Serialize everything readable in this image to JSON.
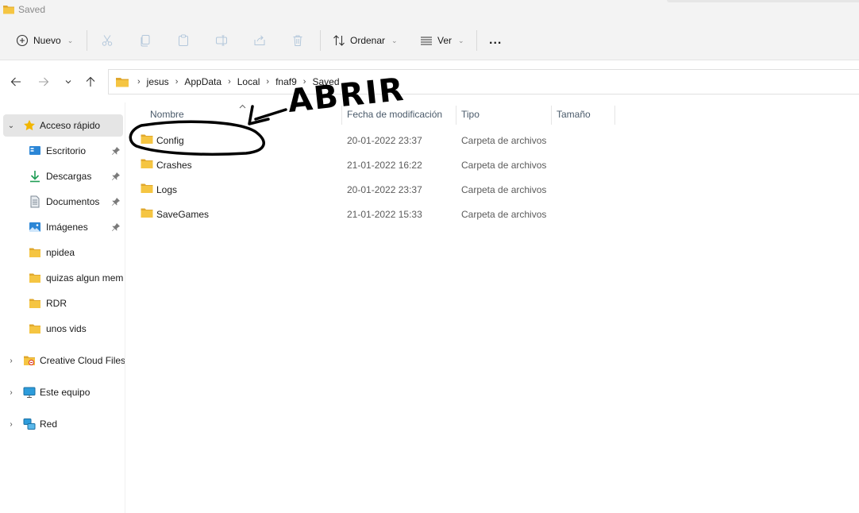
{
  "window": {
    "title": "Saved"
  },
  "toolbar": {
    "new_label": "Nuevo",
    "sort_label": "Ordenar",
    "view_label": "Ver",
    "more_label": "..."
  },
  "breadcrumb": [
    "jesus",
    "AppData",
    "Local",
    "fnaf9",
    "Saved"
  ],
  "sidebar": {
    "quick_access_label": "Acceso rápido",
    "items": [
      {
        "label": "Escritorio",
        "icon": "desktop-icon",
        "pinned": true
      },
      {
        "label": "Descargas",
        "icon": "download-icon",
        "pinned": true
      },
      {
        "label": "Documentos",
        "icon": "document-icon",
        "pinned": true
      },
      {
        "label": "Imágenes",
        "icon": "pictures-icon",
        "pinned": true
      },
      {
        "label": "npidea",
        "icon": "folder-icon",
        "pinned": false
      },
      {
        "label": "quizas algun mem",
        "icon": "folder-icon",
        "pinned": false
      },
      {
        "label": "RDR",
        "icon": "folder-icon",
        "pinned": false
      },
      {
        "label": "unos vids",
        "icon": "folder-icon",
        "pinned": false
      }
    ],
    "creative_cloud_label": "Creative Cloud Files",
    "this_pc_label": "Este equipo",
    "network_label": "Red"
  },
  "columns": {
    "name": "Nombre",
    "date": "Fecha de modificación",
    "type": "Tipo",
    "size": "Tamaño"
  },
  "files": [
    {
      "name": "Config",
      "date": "20-01-2022 23:37",
      "type": "Carpeta de archivos"
    },
    {
      "name": "Crashes",
      "date": "21-01-2022 16:22",
      "type": "Carpeta de archivos"
    },
    {
      "name": "Logs",
      "date": "20-01-2022 23:37",
      "type": "Carpeta de archivos"
    },
    {
      "name": "SaveGames",
      "date": "21-01-2022 15:33",
      "type": "Carpeta de archivos"
    }
  ],
  "annotation": {
    "text": "ABRIR"
  },
  "colors": {
    "folder": "#f5c542",
    "folder_dark": "#e0a82e",
    "accent": "#0067c0",
    "star": "#f2b600"
  }
}
